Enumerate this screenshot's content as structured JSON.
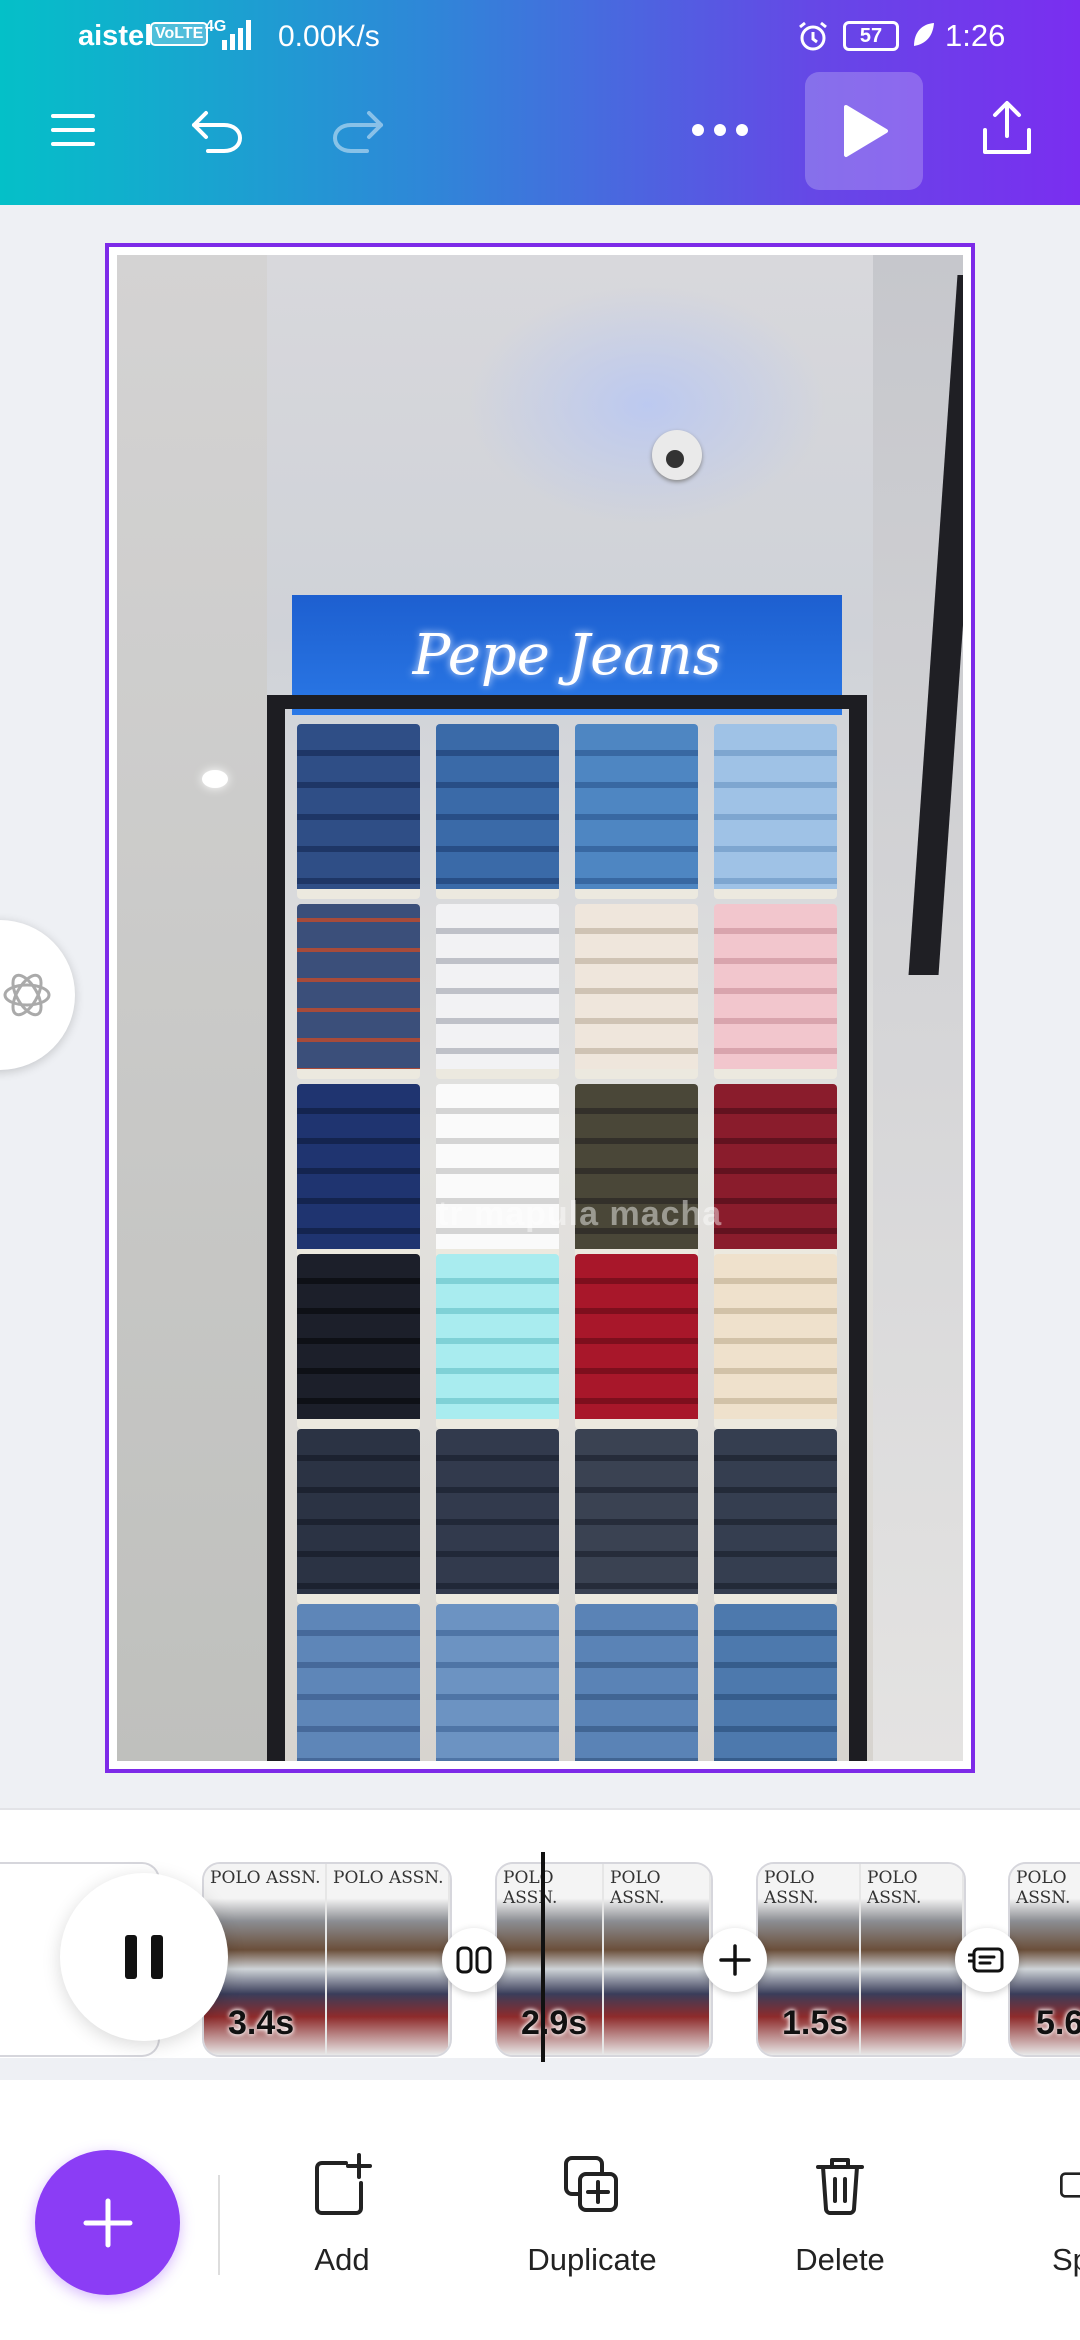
{
  "status_bar": {
    "carrier": "aistel",
    "volte": "VoLTE",
    "network": "4G",
    "speed": "0.00K/s",
    "battery": "57",
    "time": "1:26"
  },
  "toolbar_top": {
    "menu_icon": "menu-icon",
    "undo_icon": "undo-icon",
    "redo_icon": "redo-icon",
    "more_icon": "more-icon",
    "play_icon": "play-icon",
    "share_icon": "share-icon"
  },
  "canvas": {
    "sign_text": "Pepe Jeans",
    "watermark": "tr  mapula  macha",
    "frame_color": "#7d2ae8"
  },
  "timeline": {
    "clips": [
      {
        "label": "POLO ASSN.",
        "duration": "3.4s"
      },
      {
        "label": "POLO ASSN.",
        "duration": "2.9s"
      },
      {
        "label": "POLO ASSN.",
        "duration": "1.5s"
      },
      {
        "label": "POLO ASSN.",
        "duration": "5.6"
      }
    ]
  },
  "bottom_toolbar": {
    "add_label": "Add",
    "duplicate_label": "Duplicate",
    "delete_label": "Delete",
    "split_label": "Sp"
  },
  "colors": {
    "accent": "#7d2ae8",
    "fab": "#8b3df5"
  }
}
